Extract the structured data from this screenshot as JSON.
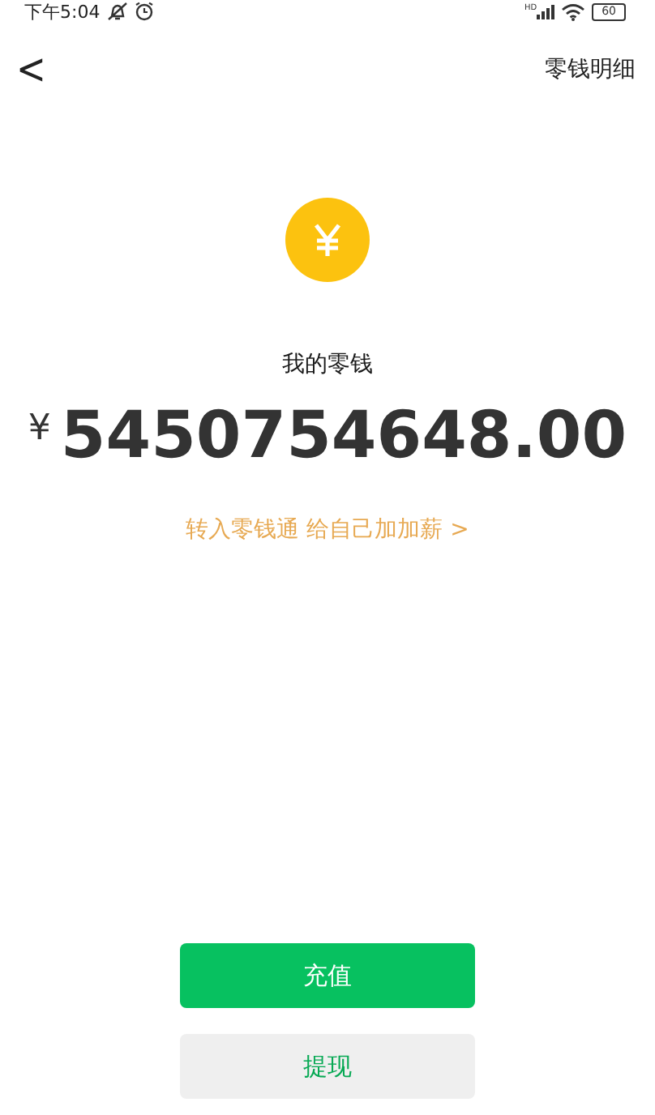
{
  "status_bar": {
    "time": "下午5:04",
    "network": "HD",
    "battery": "60"
  },
  "nav": {
    "back": "<",
    "action": "零钱明细"
  },
  "balance": {
    "label": "我的零钱",
    "currency": "¥",
    "amount": "5450754648.00"
  },
  "promo": {
    "text": "转入零钱通 给自己加加薪",
    "chevron": ">"
  },
  "buttons": [
    {
      "label": "充值",
      "kind": "primary"
    },
    {
      "label": "提现",
      "kind": "secondary"
    }
  ]
}
